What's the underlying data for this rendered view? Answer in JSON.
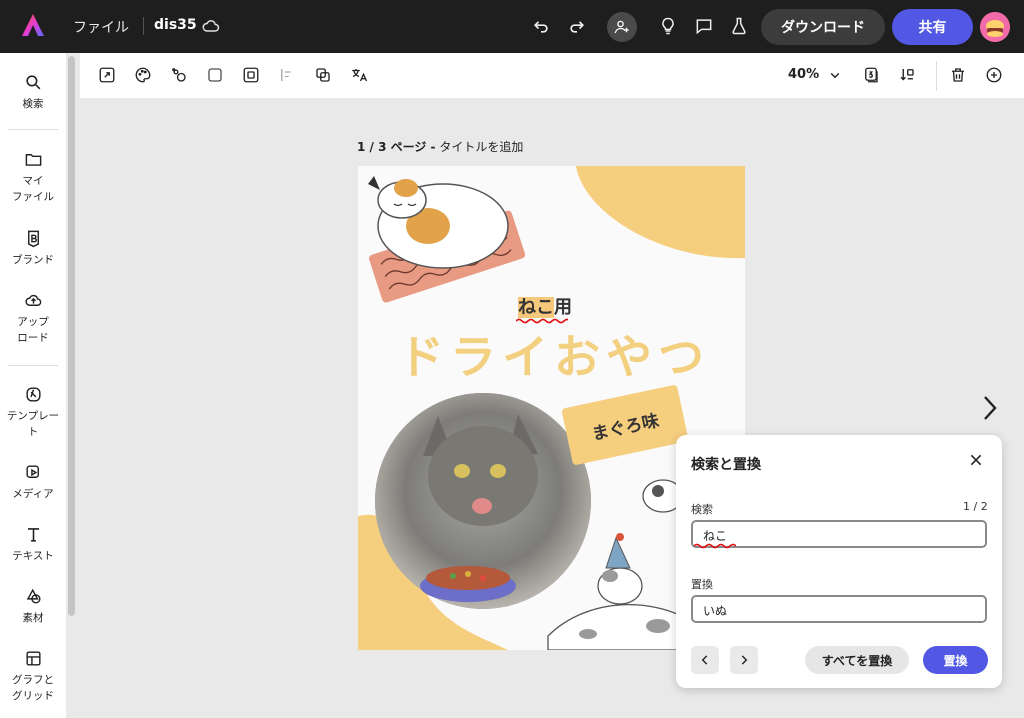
{
  "topbar": {
    "file_menu": "ファイル",
    "doc_name": "dis35",
    "download_label": "ダウンロード",
    "share_label": "共有"
  },
  "sidebar": {
    "items": [
      {
        "label": "検索",
        "icon": "search-icon"
      },
      {
        "label": "マイ\nファイル",
        "icon": "folder-icon"
      },
      {
        "label": "ブランド",
        "icon": "brand-icon"
      },
      {
        "label": "アップ\nロード",
        "icon": "upload-icon"
      },
      {
        "label": "テンプレー\nト",
        "icon": "template-icon"
      },
      {
        "label": "メディア",
        "icon": "media-icon"
      },
      {
        "label": "テキスト",
        "icon": "text-icon"
      },
      {
        "label": "素材",
        "icon": "elements-icon"
      },
      {
        "label": "グラフと\nグリッド",
        "icon": "grid-icon"
      }
    ]
  },
  "toolbar": {
    "zoom": "40%"
  },
  "canvas": {
    "page_counter": "1 / 3 ページ -",
    "add_title": "タイトルを追加",
    "neko_highlight": "ねこ",
    "neko_rest": "用",
    "headline": "ドライおやつ",
    "bubble_text": "まぐろ味"
  },
  "dialog": {
    "title": "検索と置換",
    "find_label": "検索",
    "match_count": "1 / 2",
    "find_value": "ねこ",
    "replace_label": "置換",
    "replace_value": "いぬ",
    "replace_all_label": "すべてを置換",
    "replace_label_btn": "置換"
  },
  "colors": {
    "accent": "#5258e4",
    "topbar": "#1e1e1e",
    "highlight": "#f6c87c",
    "title_yellow": "#f3cf80"
  }
}
